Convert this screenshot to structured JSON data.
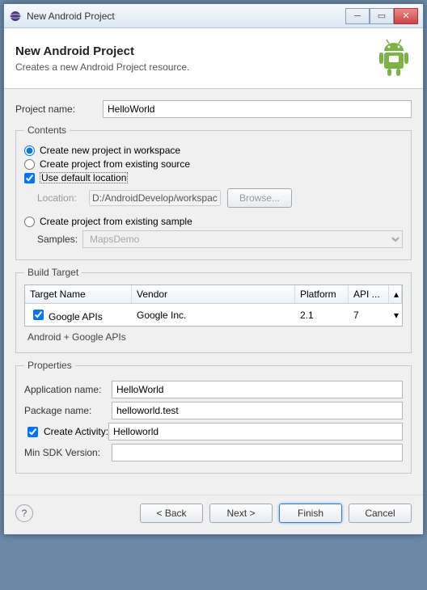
{
  "window": {
    "title": "New Android Project"
  },
  "header": {
    "title": "New Android Project",
    "subtitle": "Creates a new Android Project resource."
  },
  "project": {
    "name_label": "Project name:",
    "name_value": "HelloWorld"
  },
  "contents": {
    "legend": "Contents",
    "opt_new": "Create new project in workspace",
    "opt_existing": "Create project from existing source",
    "use_default": "Use default location",
    "location_label": "Location:",
    "location_value": "D:/AndroidDevelop/workspace/HelloWorld",
    "browse": "Browse...",
    "opt_sample": "Create project from existing sample",
    "samples_label": "Samples:",
    "samples_value": "MapsDemo"
  },
  "build": {
    "legend": "Build Target",
    "cols": {
      "target": "Target Name",
      "vendor": "Vendor",
      "platform": "Platform",
      "api": "API ..."
    },
    "rows": [
      {
        "checked": true,
        "target": "Google APIs",
        "vendor": "Google Inc.",
        "platform": "2.1",
        "api": "7"
      }
    ],
    "note": "Android + Google APIs"
  },
  "props": {
    "legend": "Properties",
    "app_label": "Application name:",
    "app_value": "HelloWorld",
    "pkg_label": "Package name:",
    "pkg_value": "helloworld.test",
    "act_label": "Create Activity:",
    "act_value": "Helloworld",
    "sdk_label": "Min SDK Version:",
    "sdk_value": ""
  },
  "footer": {
    "back": "< Back",
    "next": "Next >",
    "finish": "Finish",
    "cancel": "Cancel"
  }
}
